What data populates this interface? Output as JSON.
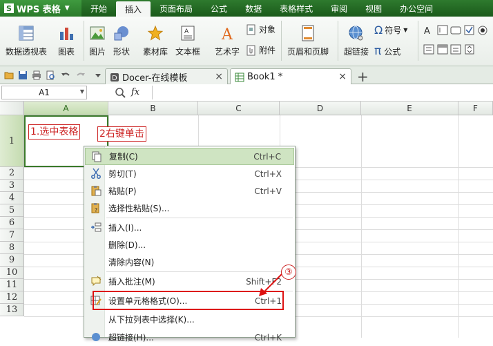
{
  "app": {
    "name": "WPS 表格",
    "logo": "S"
  },
  "menu": [
    "开始",
    "插入",
    "页面布局",
    "公式",
    "数据",
    "表格样式",
    "审阅",
    "视图",
    "办公空间"
  ],
  "menu_active": "插入",
  "ribbon": {
    "pivot": "数据透视表",
    "chart": "图表",
    "picture": "图片",
    "shape": "形状",
    "material": "素材库",
    "textbox": "文本框",
    "wordart": "艺术字",
    "object": "对象",
    "attachment": "附件",
    "header_footer": "页眉和页脚",
    "hyperlink": "超链接",
    "symbol": "符号",
    "formula": "公式",
    "symbol_glyph": "Ω",
    "formula_glyph": "π"
  },
  "tabs": [
    {
      "label": "Docer-在线模板",
      "close": "×"
    },
    {
      "label": "Book1 *",
      "close": "×"
    }
  ],
  "new_tab": "+",
  "formula_bar": {
    "cell_ref": "A1",
    "fx": "fx"
  },
  "columns": [
    "A",
    "B",
    "C",
    "D",
    "E",
    "F"
  ],
  "rows": [
    "1",
    "2",
    "3",
    "4",
    "5",
    "6",
    "7",
    "8",
    "9",
    "10",
    "11",
    "12",
    "13"
  ],
  "annotations": {
    "step1": "1.选中表格",
    "step2": "2右键单击",
    "step3": "③"
  },
  "context_menu": [
    {
      "label": "复制(C)",
      "shortcut": "Ctrl+C",
      "icon": "copy-icon"
    },
    {
      "label": "剪切(T)",
      "shortcut": "Ctrl+X",
      "icon": "scissors-icon"
    },
    {
      "label": "粘贴(P)",
      "shortcut": "Ctrl+V",
      "icon": "paste-icon"
    },
    {
      "label": "选择性粘贴(S)...",
      "shortcut": "",
      "icon": "paste-special-icon"
    },
    {
      "label": "插入(I)...",
      "shortcut": "",
      "icon": "insert-icon"
    },
    {
      "label": "删除(D)...",
      "shortcut": "",
      "icon": ""
    },
    {
      "label": "清除内容(N)",
      "shortcut": "",
      "icon": ""
    },
    {
      "label": "插入批注(M)",
      "shortcut": "Shift+F2",
      "icon": "comment-icon"
    },
    {
      "label": "设置单元格格式(O)...",
      "shortcut": "Ctrl+1",
      "icon": "format-cells-icon"
    },
    {
      "label": "从下拉列表中选择(K)...",
      "shortcut": "",
      "icon": ""
    },
    {
      "label": "超链接(H)...",
      "shortcut": "Ctrl+K",
      "icon": "hyperlink-icon"
    }
  ],
  "colors": {
    "menubar": "#1f5c1f",
    "highlight": "#cfe4c2",
    "annotation": "#cc2222"
  }
}
